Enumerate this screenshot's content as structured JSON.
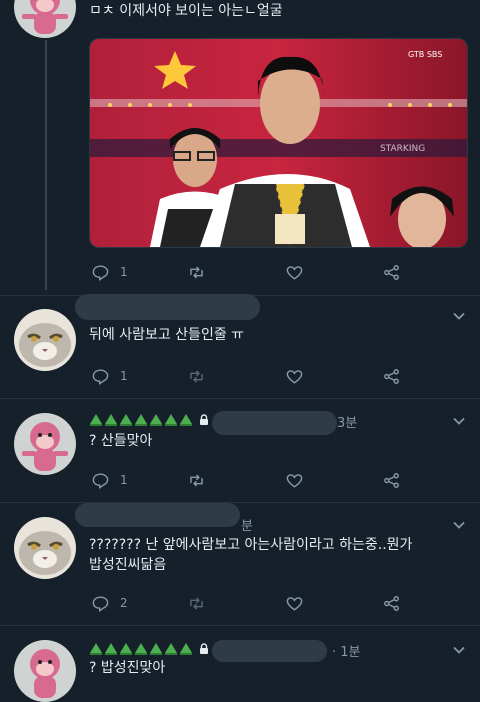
{
  "tweets": [
    {
      "text": "ㅁㅊ 이제서야 보이는 아는ㄴ얼굴",
      "actions": {
        "reply": "1",
        "retweet": "",
        "like": ""
      },
      "media": {
        "logo": "GTB SBS",
        "caption": "STARKING"
      }
    },
    {
      "text": "뒤에 사람보고 산들인줄 ㅠ",
      "actions": {
        "reply": "1",
        "retweet": "",
        "like": ""
      }
    },
    {
      "time": "3분",
      "text": "? 산들맞아",
      "actions": {
        "reply": "1",
        "retweet": "",
        "like": ""
      }
    },
    {
      "time": "분",
      "text_line1": "??????? 난 앞에사람보고 아는사람이라고 하는중..뭔가",
      "text_line2": "밥성진씨닮음",
      "actions": {
        "reply": "2",
        "retweet": "",
        "like": ""
      }
    },
    {
      "time": "· 1분",
      "text": "? 밥성진맞아"
    }
  ],
  "colors": {
    "background": "#15202b",
    "text": "#e6ecf0",
    "muted": "#8899a6",
    "emoji_green": "#4caf50"
  },
  "icons": [
    "reply-icon",
    "retweet-icon",
    "like-icon",
    "share-icon",
    "chevron-down-icon",
    "lock-icon",
    "green-tree-emoji-icon"
  ]
}
